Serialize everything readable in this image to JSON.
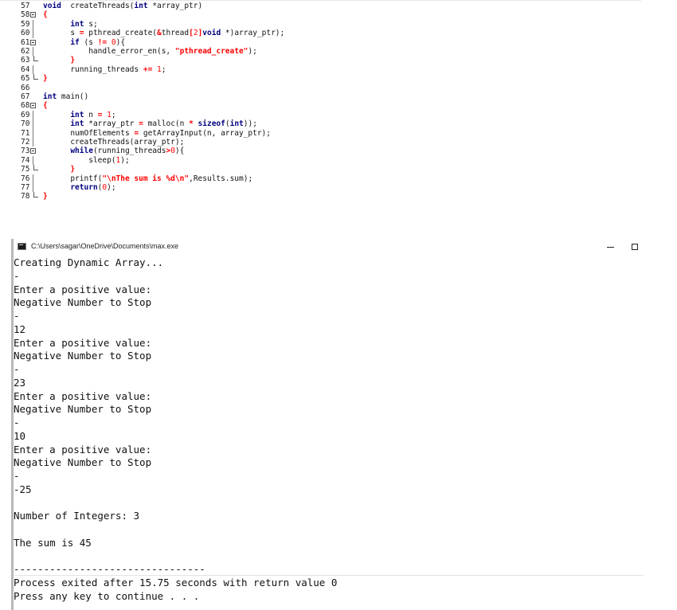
{
  "editor": {
    "lines": [
      {
        "num": "57",
        "fold": "",
        "segs": [
          [
            "kw",
            "void"
          ],
          [
            "",
            "  createThreads("
          ],
          [
            "kw",
            "int"
          ],
          [
            "",
            " *array_ptr)"
          ]
        ]
      },
      {
        "num": "58",
        "fold": "open",
        "segs": [
          [
            "brace",
            "{"
          ]
        ]
      },
      {
        "num": "59",
        "fold": "line",
        "segs": [
          [
            "",
            "      "
          ],
          [
            "kw",
            "int"
          ],
          [
            "",
            " s;"
          ]
        ]
      },
      {
        "num": "60",
        "fold": "line",
        "segs": [
          [
            "",
            "      s "
          ],
          [
            "op",
            "="
          ],
          [
            "",
            " pthread_create("
          ],
          [
            "op",
            "&"
          ],
          [
            "",
            "thread"
          ],
          [
            "op",
            "["
          ],
          [
            "num",
            "2"
          ],
          [
            "op",
            "]"
          ],
          [
            ",  NULL, findsum, ("
          ],
          [
            "kw",
            "void"
          ],
          [
            "",
            " *)array_ptr);"
          ]
        ]
      },
      {
        "num": "61",
        "fold": "open",
        "segs": [
          [
            "",
            "      "
          ],
          [
            "kw",
            "if"
          ],
          [
            "",
            " (s "
          ],
          [
            "op",
            "!="
          ],
          [
            "",
            " "
          ],
          [
            "num",
            "0"
          ],
          [
            "",
            "){"
          ]
        ]
      },
      {
        "num": "62",
        "fold": "line",
        "segs": [
          [
            "",
            "          handle_error_en(s, "
          ],
          [
            "strb",
            "\"pthread_create\""
          ],
          [
            "",
            ");"
          ]
        ]
      },
      {
        "num": "63",
        "fold": "end",
        "segs": [
          [
            "",
            "      "
          ],
          [
            "brace",
            "}"
          ]
        ]
      },
      {
        "num": "64",
        "fold": "line",
        "segs": [
          [
            "",
            "      running_threads "
          ],
          [
            "op",
            "+="
          ],
          [
            "",
            " "
          ],
          [
            "num",
            "1"
          ],
          [
            "",
            ";"
          ]
        ]
      },
      {
        "num": "65",
        "fold": "end",
        "segs": [
          [
            "brace",
            "}"
          ]
        ]
      },
      {
        "num": "66",
        "fold": "",
        "segs": []
      },
      {
        "num": "67",
        "fold": "",
        "segs": [
          [
            "kw",
            "int"
          ],
          [
            "",
            " main()"
          ]
        ]
      },
      {
        "num": "68",
        "fold": "open",
        "segs": [
          [
            "brace",
            "{"
          ]
        ]
      },
      {
        "num": "69",
        "fold": "line",
        "segs": [
          [
            "",
            "      "
          ],
          [
            "kw",
            "int"
          ],
          [
            "",
            " n "
          ],
          [
            "op",
            "="
          ],
          [
            "",
            " "
          ],
          [
            "num",
            "1"
          ],
          [
            "",
            ";"
          ]
        ]
      },
      {
        "num": "70",
        "fold": "line",
        "segs": [
          [
            "",
            "      "
          ],
          [
            "kw",
            "int"
          ],
          [
            "",
            " *array_ptr "
          ],
          [
            "op",
            "="
          ],
          [
            "",
            " malloc(n "
          ],
          [
            "op",
            "*"
          ],
          [
            "",
            " "
          ],
          [
            "kw",
            "sizeof"
          ],
          [
            "",
            "("
          ],
          [
            "kw",
            "int"
          ],
          [
            "",
            "));"
          ]
        ]
      },
      {
        "num": "71",
        "fold": "line",
        "segs": [
          [
            "",
            "      numOfElements "
          ],
          [
            "op",
            "="
          ],
          [
            "",
            " getArrayInput(n, array_ptr);"
          ]
        ]
      },
      {
        "num": "72",
        "fold": "line",
        "segs": [
          [
            "",
            "      createThreads(array_ptr);"
          ]
        ]
      },
      {
        "num": "73",
        "fold": "open",
        "segs": [
          [
            "",
            "      "
          ],
          [
            "kw",
            "while"
          ],
          [
            "",
            "(running_threads"
          ],
          [
            "op",
            ">"
          ],
          [
            "num",
            "0"
          ],
          [
            "",
            "){"
          ]
        ]
      },
      {
        "num": "74",
        "fold": "line",
        "segs": [
          [
            "",
            "          sleep("
          ],
          [
            "num",
            "1"
          ],
          [
            "",
            ");"
          ]
        ]
      },
      {
        "num": "75",
        "fold": "end",
        "segs": [
          [
            "",
            "      "
          ],
          [
            "brace",
            "}"
          ]
        ]
      },
      {
        "num": "76",
        "fold": "line",
        "segs": [
          [
            "",
            "      printf("
          ],
          [
            "strb",
            "\""
          ],
          [
            "esc",
            "\\n"
          ],
          [
            "strb",
            "The sum is %d"
          ],
          [
            "esc",
            "\\n"
          ],
          [
            "strb",
            "\""
          ],
          [
            "",
            ",Results.sum);"
          ]
        ]
      },
      {
        "num": "77",
        "fold": "line",
        "segs": [
          [
            "",
            "      "
          ],
          [
            "kw",
            "return"
          ],
          [
            "",
            "("
          ],
          [
            "num",
            "0"
          ],
          [
            "",
            ");"
          ]
        ]
      },
      {
        "num": "78",
        "fold": "end",
        "segs": [
          [
            "brace",
            "}"
          ]
        ]
      }
    ]
  },
  "console": {
    "title": "C:\\Users\\sagar\\OneDrive\\Documents\\max.exe",
    "lines": [
      "Creating Dynamic Array...",
      "-",
      "Enter a positive value:",
      "Negative Number to Stop",
      "-",
      "12",
      "Enter a positive value:",
      "Negative Number to Stop",
      "-",
      "23",
      "Enter a positive value:",
      "Negative Number to Stop",
      "-",
      "10",
      "Enter a positive value:",
      "Negative Number to Stop",
      "-",
      "-25",
      "",
      "Number of Integers: 3",
      "",
      "The sum is 45",
      "",
      "--------------------------------",
      "Process exited after 15.75 seconds with return value 0",
      "Press any key to continue . . ."
    ]
  },
  "colors": {
    "keyword": "#000080",
    "string": "#ff0000",
    "number": "#ff0000",
    "console_text": "#111111"
  },
  "icons": {
    "app": "console-window-icon",
    "minimize": "minimize-icon",
    "maximize": "maximize-icon"
  }
}
